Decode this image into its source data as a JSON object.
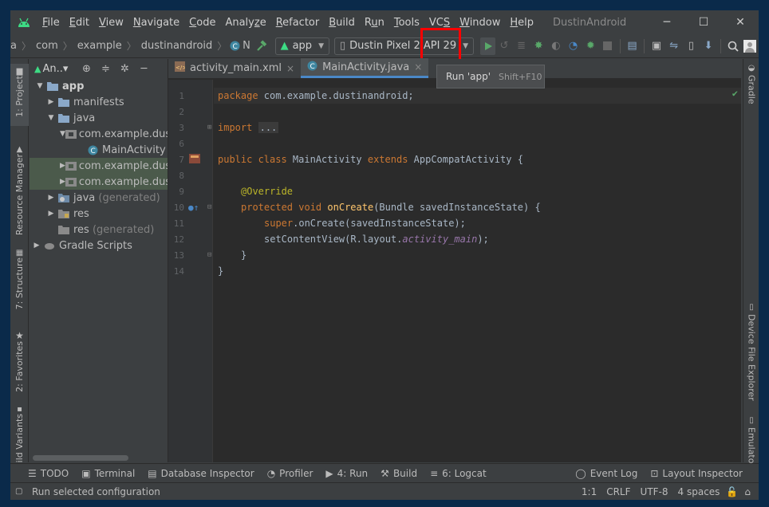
{
  "menubar": {
    "items": [
      {
        "label": "File",
        "mnemonic": "F"
      },
      {
        "label": "Edit",
        "mnemonic": "E"
      },
      {
        "label": "View",
        "mnemonic": "V"
      },
      {
        "label": "Navigate",
        "mnemonic": "N"
      },
      {
        "label": "Code",
        "mnemonic": "C"
      },
      {
        "label": "Analyze",
        "mnemonic": "z"
      },
      {
        "label": "Refactor",
        "mnemonic": "R"
      },
      {
        "label": "Build",
        "mnemonic": "B"
      },
      {
        "label": "Run",
        "mnemonic": "u"
      },
      {
        "label": "Tools",
        "mnemonic": "T"
      },
      {
        "label": "VCS",
        "mnemonic": "S"
      },
      {
        "label": "Window",
        "mnemonic": "W"
      },
      {
        "label": "Help",
        "mnemonic": "H"
      }
    ],
    "window_title": "DustinAndroid",
    "controls": {
      "minimize": "─",
      "maximize": "☐",
      "close": "✕"
    }
  },
  "toolbar": {
    "breadcrumbs": [
      "a",
      "com",
      "example",
      "dustinandroid",
      "N"
    ],
    "run_config": "app",
    "device": "Dustin Pixel 2 API 29"
  },
  "tooltip": {
    "label": "Run 'app'",
    "shortcut": "Shift+F10"
  },
  "left_strip": {
    "tabs": [
      {
        "label": "1: Project"
      },
      {
        "label": "Resource Manager"
      },
      {
        "label": "7: Structure"
      },
      {
        "label": "2: Favorites"
      },
      {
        "label": "Build Variants"
      }
    ]
  },
  "right_strip": {
    "tabs": [
      {
        "label": "Gradle"
      },
      {
        "label": "Device File Explorer"
      },
      {
        "label": "Emulator"
      }
    ]
  },
  "project": {
    "view_label": "An..▾",
    "tree": [
      {
        "label": "app",
        "suffix": ""
      },
      {
        "label": "manifests",
        "suffix": ""
      },
      {
        "label": "java",
        "suffix": ""
      },
      {
        "label": "com.example.dust",
        "suffix": ""
      },
      {
        "label": "MainActivity",
        "suffix": ""
      },
      {
        "label": "com.example.dust",
        "suffix": ""
      },
      {
        "label": "com.example.dust",
        "suffix": ""
      },
      {
        "label": "java",
        "suffix": "(generated)"
      },
      {
        "label": "res",
        "suffix": ""
      },
      {
        "label": "res",
        "suffix": "(generated)"
      },
      {
        "label": "Gradle Scripts",
        "suffix": ""
      }
    ]
  },
  "editor": {
    "tabs": [
      {
        "label": "activity_main.xml",
        "close": "×"
      },
      {
        "label": "MainActivity.java",
        "close": "×"
      }
    ],
    "line_numbers": [
      "1",
      "2",
      "3",
      "6",
      "7",
      "8",
      "9",
      "10",
      "11",
      "12",
      "13",
      "14"
    ],
    "code": {
      "l1_kw": "package",
      "l1_rest": " com.example.dustinandroid;",
      "l3_kw": "import",
      "l3_fold": "...",
      "l7_kw": "public class",
      "l7_name": " MainActivity ",
      "l7_kw2": "extends",
      "l7_rest": " AppCompatActivity {",
      "l9_ann": "@Override",
      "l10_kw": "protected void",
      "l10_fn": "onCreate",
      "l10_rest": "(Bundle savedInstanceState) {",
      "l11_kw": "super",
      "l11_rest": ".onCreate(savedInstanceState);",
      "l12_pre": "setContentView(R.layout.",
      "l12_it": "activity_main",
      "l12_post": ");",
      "l13": "}",
      "l14": "}"
    }
  },
  "bottom_tools": {
    "left": [
      {
        "label": "TODO"
      },
      {
        "label": "Terminal"
      },
      {
        "label": "Database Inspector"
      },
      {
        "label": "Profiler"
      },
      {
        "label": "4: Run"
      },
      {
        "label": "Build"
      },
      {
        "label": "6: Logcat"
      }
    ],
    "right": [
      {
        "label": "Event Log"
      },
      {
        "label": "Layout Inspector"
      }
    ]
  },
  "status": {
    "message": "Run selected configuration",
    "position": "1:1",
    "line_sep": "CRLF",
    "encoding": "UTF-8",
    "indent": "4 spaces"
  },
  "colors": {
    "accent": "#4a88c7",
    "run_green": "#59a869",
    "highlight": "#ff0000"
  }
}
